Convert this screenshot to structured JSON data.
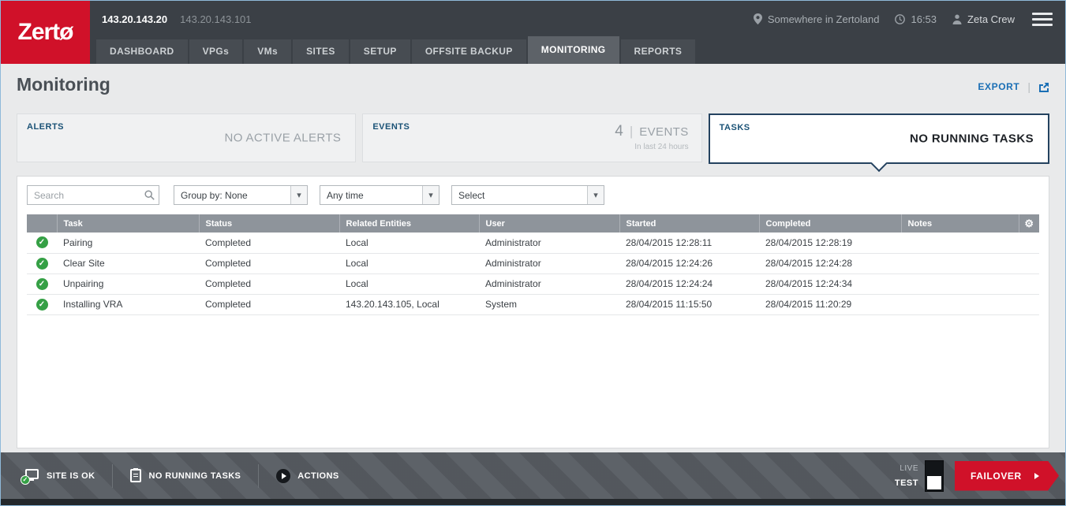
{
  "colors": {
    "brand_red": "#d01129",
    "link_blue": "#1a6fb5",
    "success_green": "#35a045",
    "active_card_border": "#24425f",
    "header_dark": "#3b4046"
  },
  "icons": {
    "gear": "⚙",
    "dropdown_arrow": "▾",
    "check": "✓",
    "divider": "|"
  },
  "header": {
    "logo_text": "Zertø",
    "primary_ip": "143.20.143.20",
    "secondary_ip": "143.20.143.101",
    "location": "Somewhere in Zertoland",
    "time": "16:53",
    "user": "Zeta Crew"
  },
  "nav": {
    "active": "MONITORING",
    "tabs": [
      {
        "label": "DASHBOARD"
      },
      {
        "label": "VPGs"
      },
      {
        "label": "VMs"
      },
      {
        "label": "SITES"
      },
      {
        "label": "SETUP"
      },
      {
        "label": "OFFSITE BACKUP"
      },
      {
        "label": "MONITORING"
      },
      {
        "label": "REPORTS"
      }
    ]
  },
  "page": {
    "title": "Monitoring",
    "export_label": "EXPORT"
  },
  "cards": {
    "alerts": {
      "title": "ALERTS",
      "status": "NO ACTIVE ALERTS"
    },
    "events": {
      "title": "EVENTS",
      "count": "4",
      "unit": "EVENTS",
      "subtitle": "In last 24 hours"
    },
    "tasks": {
      "title": "TASKS",
      "status": "NO RUNNING TASKS"
    }
  },
  "filters": {
    "search_placeholder": "Search",
    "group_by": "Group by: None",
    "time_range": "Any time",
    "select": "Select"
  },
  "table": {
    "columns": {
      "task": "Task",
      "status": "Status",
      "related": "Related Entities",
      "user": "User",
      "started": "Started",
      "completed": "Completed",
      "notes": "Notes"
    },
    "rows": [
      {
        "task": "Pairing",
        "status": "Completed",
        "related": "Local",
        "user": "Administrator",
        "started": "28/04/2015 12:28:11",
        "completed": "28/04/2015 12:28:19",
        "notes": ""
      },
      {
        "task": "Clear Site",
        "status": "Completed",
        "related": "Local",
        "user": "Administrator",
        "started": "28/04/2015 12:24:26",
        "completed": "28/04/2015 12:24:28",
        "notes": ""
      },
      {
        "task": "Unpairing",
        "status": "Completed",
        "related": "Local",
        "user": "Administrator",
        "started": "28/04/2015 12:24:24",
        "completed": "28/04/2015 12:24:34",
        "notes": ""
      },
      {
        "task": "Installing VRA",
        "status": "Completed",
        "related": "143.20.143.105, Local",
        "user": "System",
        "started": "28/04/2015 11:15:50",
        "completed": "28/04/2015 11:20:29",
        "notes": ""
      }
    ]
  },
  "footer": {
    "site_status": "SITE IS OK",
    "tasks_status": "NO RUNNING TASKS",
    "actions_label": "ACTIONS",
    "live_label": "LIVE",
    "test_label": "TEST",
    "failover_label": "FAILOVER"
  }
}
